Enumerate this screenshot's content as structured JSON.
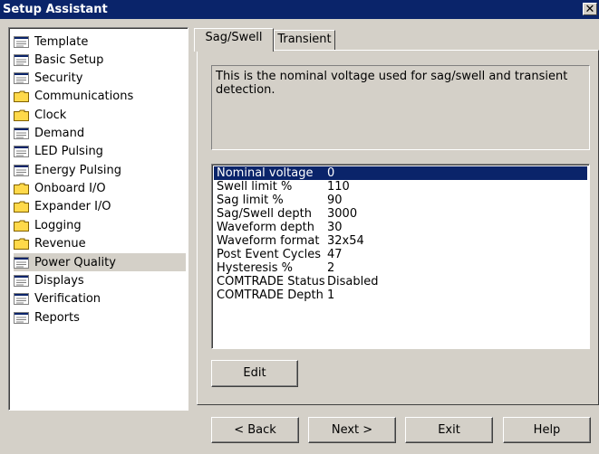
{
  "window": {
    "title": "Setup Assistant",
    "close_glyph": "✕"
  },
  "nav": {
    "items": [
      {
        "label": "Template",
        "icon": "page-icon"
      },
      {
        "label": "Basic Setup",
        "icon": "page-icon"
      },
      {
        "label": "Security",
        "icon": "page-icon"
      },
      {
        "label": "Communications",
        "icon": "folder-icon"
      },
      {
        "label": "Clock",
        "icon": "folder-icon"
      },
      {
        "label": "Demand",
        "icon": "page-icon"
      },
      {
        "label": "LED Pulsing",
        "icon": "page-icon"
      },
      {
        "label": "Energy Pulsing",
        "icon": "page-icon"
      },
      {
        "label": "Onboard I/O",
        "icon": "folder-icon"
      },
      {
        "label": "Expander I/O",
        "icon": "folder-icon"
      },
      {
        "label": "Logging",
        "icon": "folder-icon"
      },
      {
        "label": "Revenue",
        "icon": "folder-icon"
      },
      {
        "label": "Power Quality",
        "icon": "page-icon",
        "selected": true
      },
      {
        "label": "Displays",
        "icon": "page-icon"
      },
      {
        "label": "Verification",
        "icon": "page-icon"
      },
      {
        "label": "Reports",
        "icon": "page-icon"
      }
    ]
  },
  "tabs": [
    {
      "label": "Sag/Swell",
      "active": true
    },
    {
      "label": "Transient",
      "active": false
    }
  ],
  "description": "This is the nominal voltage used for sag/swell and transient detection.",
  "params": [
    {
      "name": "Nominal voltage",
      "value": "0",
      "selected": true
    },
    {
      "name": "Swell limit %",
      "value": "110"
    },
    {
      "name": "Sag limit %",
      "value": "90"
    },
    {
      "name": "Sag/Swell depth",
      "value": "3000"
    },
    {
      "name": "Waveform depth",
      "value": "30"
    },
    {
      "name": "Waveform format",
      "value": "32x54"
    },
    {
      "name": "Post Event Cycles",
      "value": "47"
    },
    {
      "name": "Hysteresis %",
      "value": "2"
    },
    {
      "name": "COMTRADE Status",
      "value": "Disabled"
    },
    {
      "name": "COMTRADE Depth",
      "value": "1"
    }
  ],
  "buttons": {
    "edit": "Edit",
    "back": "< Back",
    "next": "Next >",
    "exit": "Exit",
    "help": "Help"
  },
  "colors": {
    "title_bar": "#0a246a",
    "selection": "#0a246a",
    "face": "#d4d0c8",
    "folder": "#ffd94a"
  }
}
